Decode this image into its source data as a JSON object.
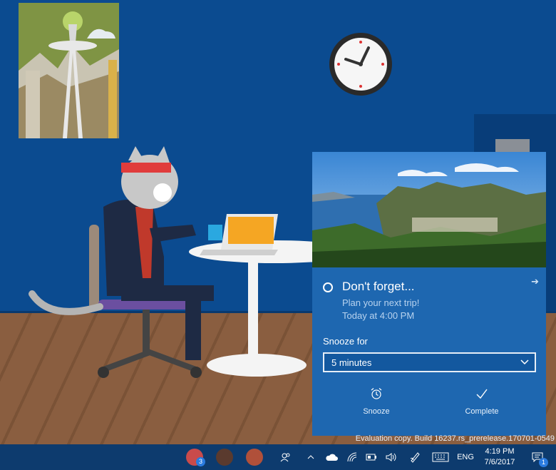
{
  "toast": {
    "title": "Don't forget...",
    "subtitle": "Plan your next trip!",
    "time": "Today at 4:00 PM",
    "snooze_label": "Snooze for",
    "snooze_value": "5 minutes",
    "actions": [
      {
        "label": "Snooze",
        "icon": "alarm-clock-icon"
      },
      {
        "label": "Complete",
        "icon": "checkmark-icon"
      }
    ]
  },
  "watermark": "Evaluation copy. Build 16237.rs_prerelease.170701-0549",
  "taskbar": {
    "people": [
      {
        "badge": "3"
      },
      {
        "badge": ""
      },
      {
        "badge": ""
      }
    ],
    "language": "ENG",
    "clock_time": "4:19 PM",
    "clock_date": "7/6/2017",
    "notification_count": "1"
  }
}
